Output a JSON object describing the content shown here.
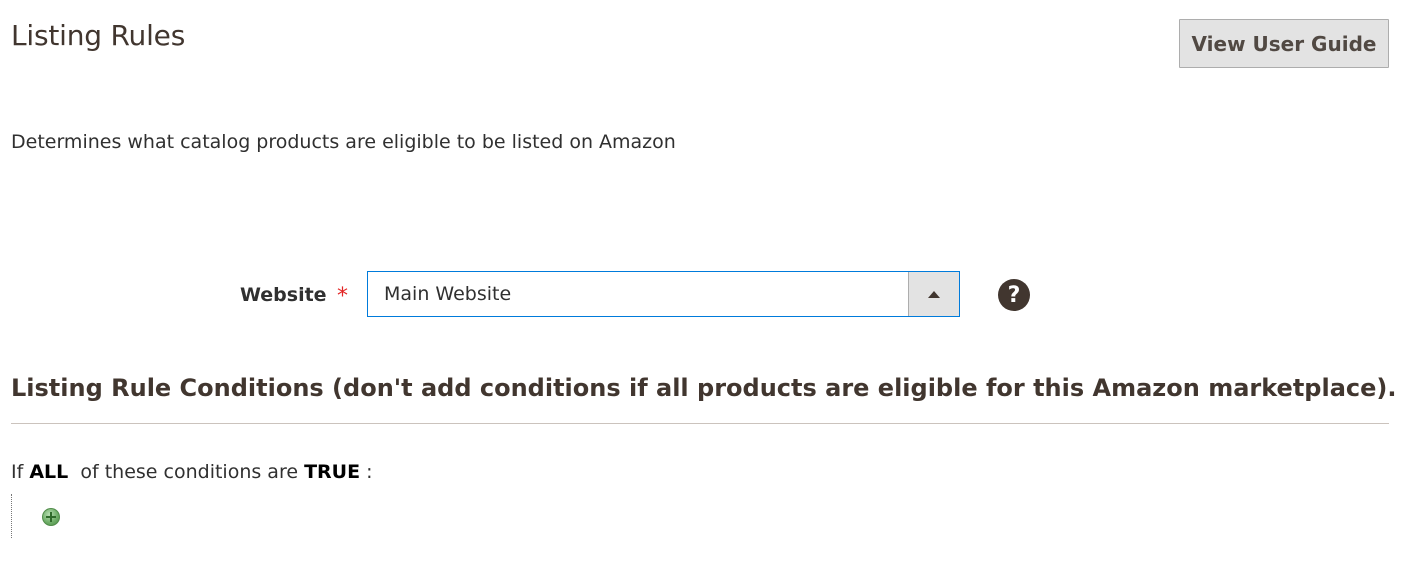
{
  "header": {
    "title": "Listing Rules",
    "guide_button_label": "View User Guide"
  },
  "description": "Determines what catalog products are eligible to be listed on Amazon",
  "website_field": {
    "label": "Website",
    "required_marker": "*",
    "selected_value": "Main Website",
    "help_icon_glyph": "?"
  },
  "conditions": {
    "section_title": "Listing Rule Conditions (don't add conditions if all products are eligible for this Amazon marketplace).",
    "prefix": "If",
    "aggregator": "ALL",
    "middle": "of these conditions are",
    "value": "TRUE",
    "suffix": ":"
  },
  "icons": {
    "help": "question-circle-icon",
    "add": "add-condition-plus-icon",
    "dropdown": "caret-up-icon"
  },
  "colors": {
    "focus_border": "#007bdb",
    "required": "#e22626",
    "button_bg": "#e3e3e3",
    "title_text": "#41362f"
  }
}
